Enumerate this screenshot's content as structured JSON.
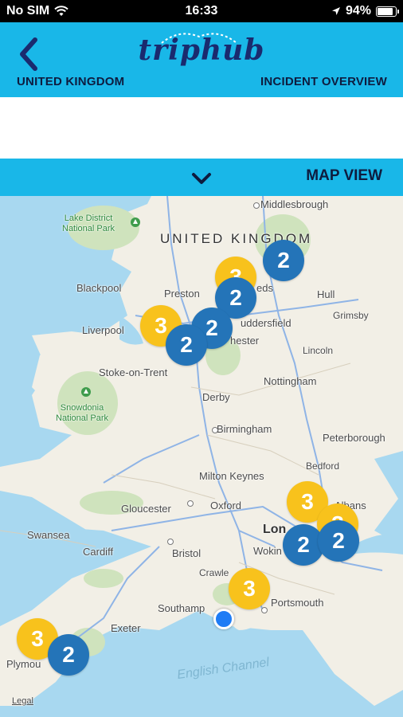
{
  "status_bar": {
    "carrier": "No SIM",
    "time": "16:33",
    "battery_percent": "94%",
    "battery_level": 0.94,
    "icons": [
      "wifi-icon",
      "location-arrow-icon",
      "battery-icon"
    ]
  },
  "header": {
    "logo_text": "triphub",
    "country": "UNITED KINGDOM",
    "section": "INCIDENT OVERVIEW",
    "back_icon": "chevron-left-icon"
  },
  "map_bar": {
    "label": "MAP VIEW",
    "toggle_icon": "chevron-down-icon"
  },
  "map": {
    "country_label": "UNITED KINGDOM",
    "places": {
      "middlesbrough": "Middlesbrough",
      "blackpool": "Blackpool",
      "preston": "Preston",
      "leeds": "eds",
      "hull": "Hull",
      "grimsby": "Grimsby",
      "liverpool": "Liverpool",
      "huddersfield": "uddersfield",
      "manchester": "hester",
      "lincoln": "Lincoln",
      "stoke": "Stoke-on-Trent",
      "nottingham": "Nottingham",
      "derby": "Derby",
      "birmingham": "Birmingham",
      "peterborough": "Peterborough",
      "bedford": "Bedford",
      "milton_keynes": "Milton Keynes",
      "albans": "Albans",
      "gloucester": "Gloucester",
      "oxford": "Oxford",
      "swansea": "Swansea",
      "london": "Lon",
      "cardiff": "Cardiff",
      "bristol": "Bristol",
      "woking": "Wokin",
      "crawley": "Crawle",
      "southampton": "Southamp",
      "portsmouth": "Portsmouth",
      "exeter": "Exeter",
      "plymouth": "Plymou"
    },
    "parks": {
      "lake_district": "Lake District\nNational Park",
      "snowdonia": "Snowdonia\nNational Park"
    },
    "sea_label": "English Channel",
    "legal": "Legal",
    "clusters": [
      {
        "id": "newcastle",
        "count": "2",
        "color": "blue"
      },
      {
        "id": "york-yellow",
        "count": "3",
        "color": "yellow"
      },
      {
        "id": "leeds",
        "count": "2",
        "color": "blue"
      },
      {
        "id": "liverpool",
        "count": "3",
        "color": "yellow"
      },
      {
        "id": "manchester-a",
        "count": "2",
        "color": "blue"
      },
      {
        "id": "manchester-b",
        "count": "2",
        "color": "blue"
      },
      {
        "id": "north-london",
        "count": "3",
        "color": "yellow"
      },
      {
        "id": "london-yellow",
        "count": "3",
        "color": "yellow"
      },
      {
        "id": "london-a",
        "count": "2",
        "color": "blue"
      },
      {
        "id": "london-b",
        "count": "2",
        "color": "blue"
      },
      {
        "id": "brighton",
        "count": "3",
        "color": "yellow"
      },
      {
        "id": "plymouth-yellow",
        "count": "3",
        "color": "yellow"
      },
      {
        "id": "plymouth-blue",
        "count": "2",
        "color": "blue"
      }
    ]
  },
  "colors": {
    "brand_blue": "#19b7e8",
    "navy": "#1a2a6e",
    "cluster_yellow": "#f8c21c",
    "cluster_blue": "#2474b8",
    "sea": "#a8d8f0",
    "land": "#f2efe6",
    "park_green": "#cfe3bd"
  }
}
